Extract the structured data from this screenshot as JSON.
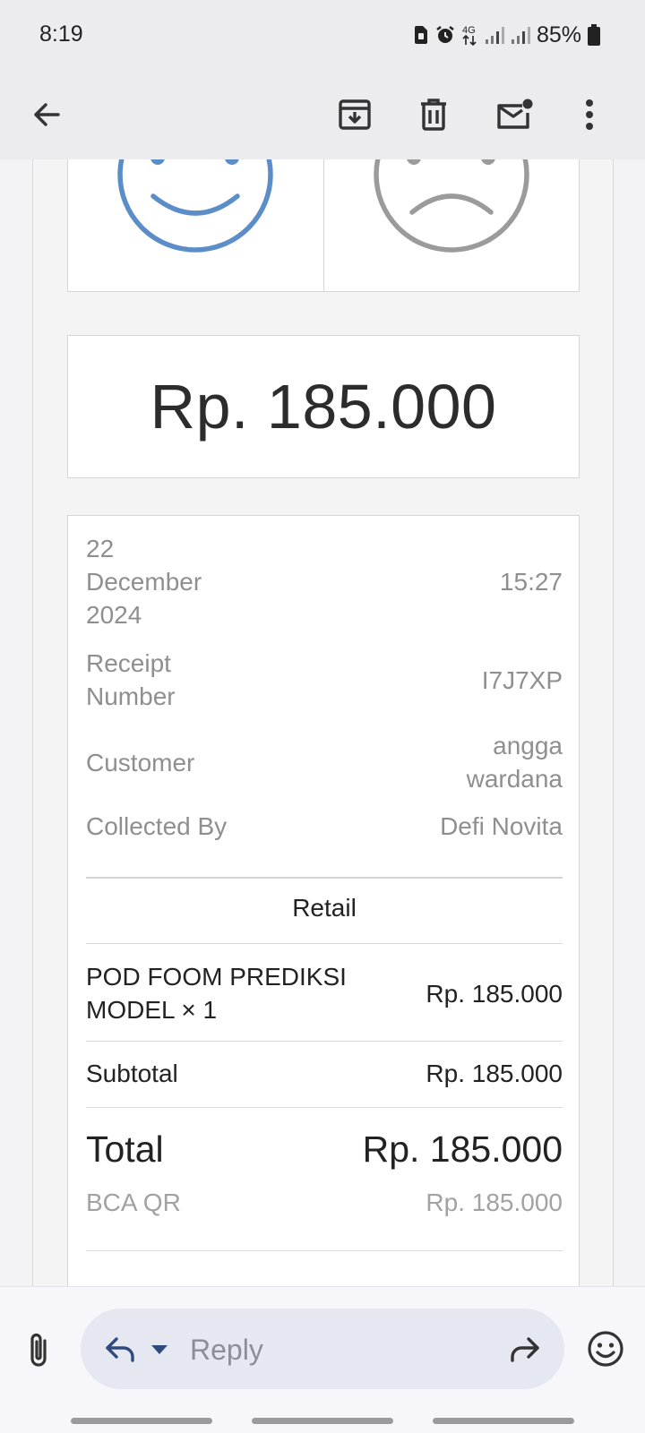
{
  "status_bar": {
    "time": "8:19",
    "network": "4G",
    "battery": "85%"
  },
  "toolbar": {
    "back_icon": "arrow-left-icon",
    "archive_icon": "archive-icon",
    "delete_icon": "trash-icon",
    "unread_icon": "mail-unread-icon",
    "more_icon": "more-vertical-icon"
  },
  "feedback": {
    "positive_icon": "smiley-happy-icon",
    "negative_icon": "smiley-sad-icon",
    "positive_color": "#5b8dc9",
    "negative_color": "#9b9b9b"
  },
  "receipt": {
    "amount": "Rp. 185.000",
    "date_day": "22",
    "date_month": "December",
    "date_year": "2024",
    "time": "15:27",
    "receipt_number_label_1": "Receipt",
    "receipt_number_label_2": "Number",
    "receipt_number": "I7J7XP",
    "customer_label": "Customer",
    "customer_name_1": "angga",
    "customer_name_2": "wardana",
    "collected_by_label": "Collected By",
    "collected_by": "Defi Novita",
    "section_title": "Retail",
    "item_name_1": "POD FOOM PREDIKSI",
    "item_name_2": "MODEL × 1",
    "item_price": "Rp. 185.000",
    "subtotal_label": "Subtotal",
    "subtotal_value": "Rp. 185.000",
    "total_label": "Total",
    "total_value": "Rp. 185.000",
    "payment_method": "BCA QR",
    "payment_value": "Rp. 185.000"
  },
  "reply_bar": {
    "attach_icon": "paperclip-icon",
    "reply_icon": "reply-icon",
    "dropdown_icon": "caret-down-icon",
    "placeholder": "Reply",
    "forward_icon": "forward-icon",
    "emoji_icon": "emoji-icon"
  }
}
